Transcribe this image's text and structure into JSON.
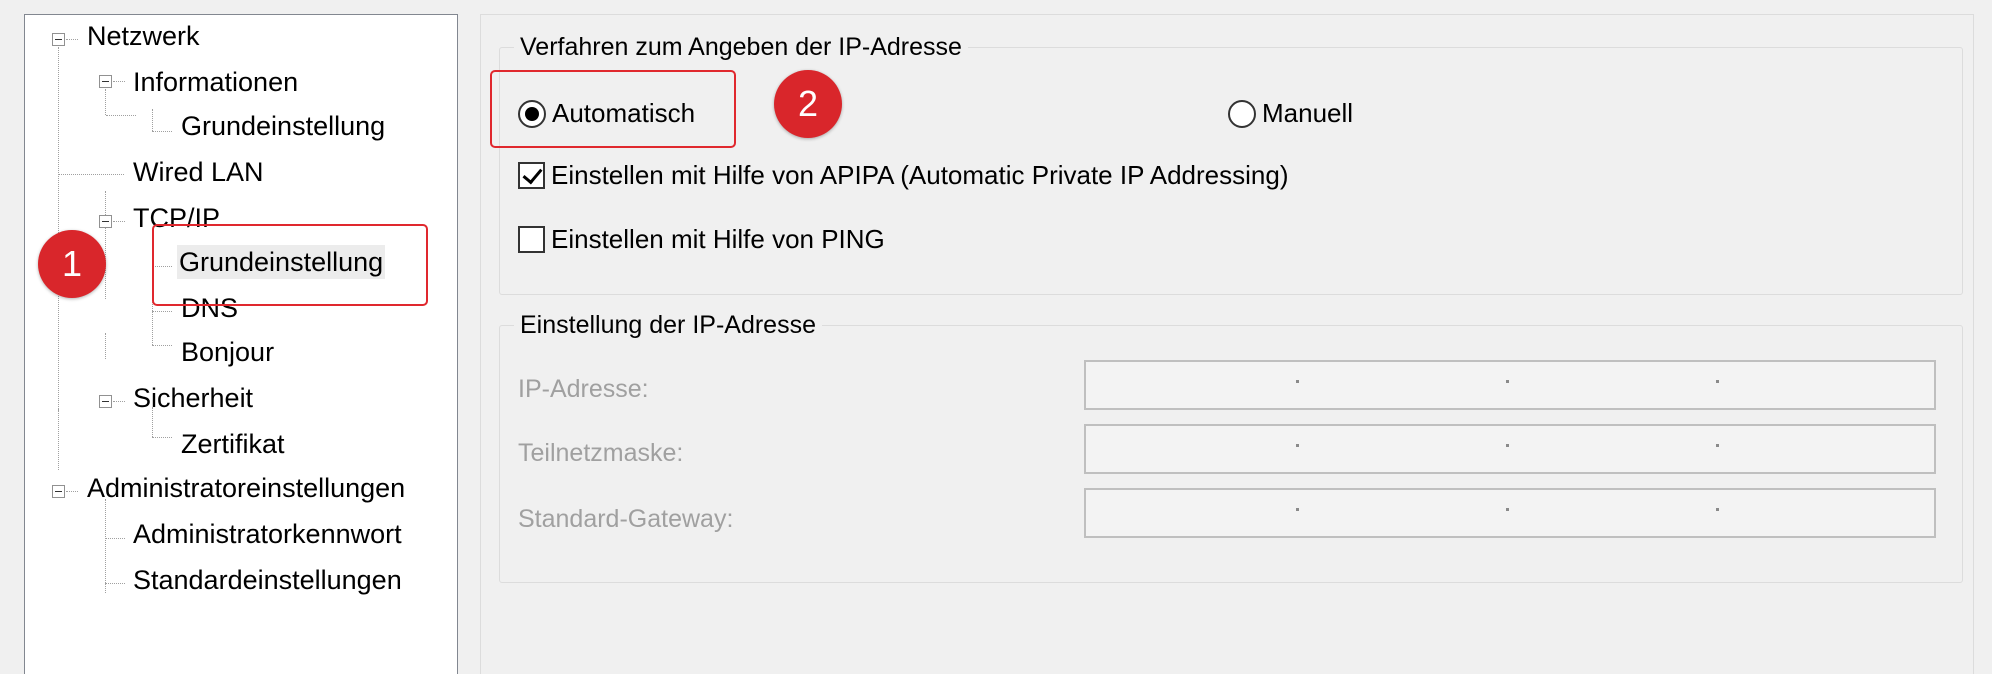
{
  "tree": {
    "items": [
      {
        "label": "Netzwerk",
        "level": 0,
        "expanded": true
      },
      {
        "label": "Informationen",
        "level": 1,
        "expanded": true
      },
      {
        "label": "Grundeinstellung",
        "level": 2
      },
      {
        "label": "Wired LAN",
        "level": 1
      },
      {
        "label": "TCP/IP",
        "level": 1,
        "expanded": true
      },
      {
        "label": "Grundeinstellung",
        "level": 2,
        "selected": true
      },
      {
        "label": "DNS",
        "level": 2
      },
      {
        "label": "Bonjour",
        "level": 2
      },
      {
        "label": "Sicherheit",
        "level": 1,
        "expanded": true
      },
      {
        "label": "Zertifikat",
        "level": 2
      },
      {
        "label": "Administratoreinstellungen",
        "level": 0,
        "expanded": true
      },
      {
        "label": "Administratorkennwort",
        "level": 1
      },
      {
        "label": "Standardeinstellungen",
        "level": 1
      }
    ]
  },
  "method_group": {
    "title": "Verfahren zum Angeben der IP-Adresse",
    "auto_label": "Automatisch",
    "manual_label": "Manuell",
    "auto_selected": true,
    "apipa_label": "Einstellen mit Hilfe von APIPA (Automatic Private IP Addressing)",
    "apipa_checked": true,
    "ping_label": "Einstellen mit Hilfe von PING",
    "ping_checked": false
  },
  "ip_group": {
    "title": "Einstellung der IP-Adresse",
    "ip_label": "IP-Adresse:",
    "mask_label": "Teilnetzmaske:",
    "gateway_label": "Standard-Gateway:"
  },
  "annotations": {
    "badge1": "1",
    "badge2": "2",
    "color": "#d9262b"
  }
}
